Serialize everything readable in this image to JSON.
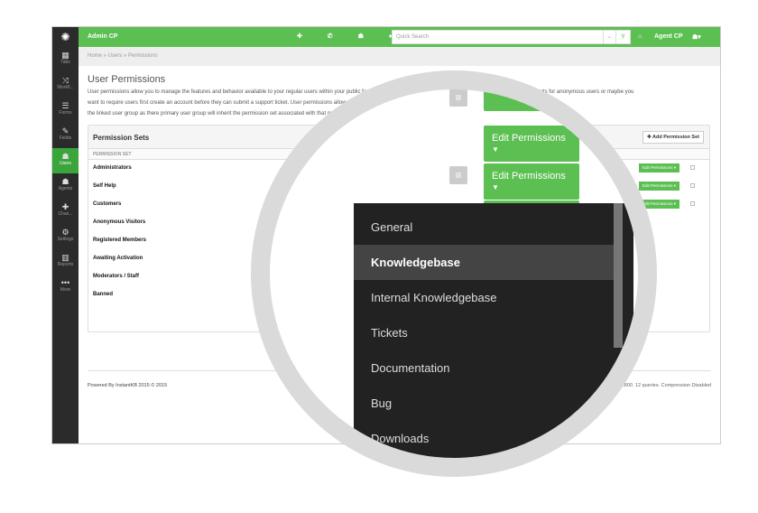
{
  "app": {
    "brand": "Admin CP",
    "search_placeholder": "Quick Search",
    "agent_cp": "Agent CP",
    "top_icons": "✚ ✆ ☗ ♦"
  },
  "sidebar": {
    "items": [
      {
        "label": "Tabs",
        "icon": "▦"
      },
      {
        "label": "Workfl...",
        "icon": "⤨"
      },
      {
        "label": "Forms",
        "icon": "☰"
      },
      {
        "label": "Fields",
        "icon": "✎"
      },
      {
        "label": "Users",
        "icon": "☗"
      },
      {
        "label": "Agents",
        "icon": "☗"
      },
      {
        "label": "Chan...",
        "icon": "✚"
      },
      {
        "label": "Settings",
        "icon": "⚙"
      },
      {
        "label": "Reports",
        "icon": "▥"
      },
      {
        "label": "More",
        "icon": "•••"
      }
    ]
  },
  "breadcrumb": "Home  »  Users  »  Permissions",
  "page": {
    "title": "User Permissions",
    "desc": [
      "User permissions allow you to manage the features and behavior available to your regular users within your public facing support tool. For example maybe you want to disable article comments for anonymous users or maybe you",
      "want to require users first create an account before they can submit a support ticket. User permissions allow you to... Each user permission set is linked to one or more user group. Users who have",
      "the linked user group as there primary user group will inherit the permission set associated with that group... anonymous visitors permission set."
    ]
  },
  "panel": {
    "title": "Permission Sets",
    "add_label": "Add Permission Set",
    "column": "PERMISSION SET",
    "edit_label": "Edit Permissions",
    "rows": [
      "Administrators",
      "Self Help",
      "Customers",
      "Anonymous Visitors",
      "Registered Members",
      "Awaiting Activation",
      "Moderators / Staff",
      "Banned"
    ]
  },
  "footer": {
    "left": "Powered By InstantKB 2015 © 2015",
    "right": "... 0.800. 12 queries. Compression Disabled"
  },
  "magnifier": {
    "edit_label": "Edit Permissions",
    "menu": [
      "General",
      "Knowledgebase",
      "Internal Knowledgebase",
      "Tickets",
      "Documentation",
      "Bug",
      "Downloads"
    ],
    "selected": "Knowledgebase"
  },
  "colors": {
    "green": "#5cbf52",
    "dark": "#2b2b2b"
  }
}
